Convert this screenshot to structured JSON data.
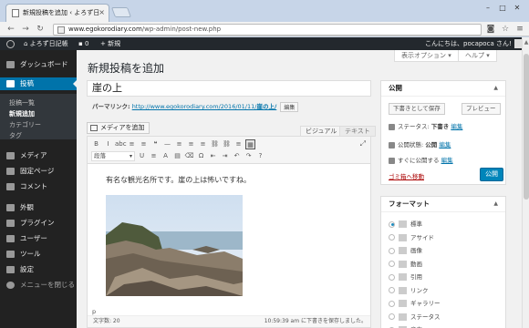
{
  "browser": {
    "tab_title": "新規投稿を追加 ‹ よろず日",
    "url_host": "www.egokorodiary.com",
    "url_path": "/wp-admin/post-new.php"
  },
  "adminbar": {
    "site_name": "よろず日記帳",
    "comments_count": "0",
    "new_label": "新規",
    "greeting": "こんにちは、pocapoca さん!"
  },
  "sidebar": {
    "items": [
      {
        "label": "ダッシュボード"
      },
      {
        "label": "投稿"
      },
      {
        "label": "メディア"
      },
      {
        "label": "固定ページ"
      },
      {
        "label": "コメント"
      },
      {
        "label": "外観"
      },
      {
        "label": "プラグイン"
      },
      {
        "label": "ユーザー"
      },
      {
        "label": "ツール"
      },
      {
        "label": "設定"
      },
      {
        "label": "メニューを閉じる"
      }
    ],
    "submenu": [
      "投稿一覧",
      "新規追加",
      "カテゴリー",
      "タグ"
    ]
  },
  "page": {
    "title": "新規投稿を追加",
    "screen_options": "表示オプション ▾",
    "help": "ヘルプ ▾"
  },
  "post": {
    "title_value": "崖の上",
    "permalink_label": "パーマリンク:",
    "permalink_base": "http://www.egokorodiary.com/2016/01/11/",
    "permalink_slug": "崖の上/",
    "edit_label": "編集"
  },
  "editor": {
    "media_button": "メディアを追加",
    "tab_visual": "ビジュアル",
    "tab_text": "テキスト",
    "format_select": "段落",
    "content_text": "有名な観光名所です。崖の上は怖いですね。",
    "path": "p",
    "word_count": "文字数: 20",
    "draft_status": "10:59:39 am に下書きを保存しました。",
    "toolbar_row1": [
      "B",
      "I",
      "abc",
      "≡",
      "≡",
      "❝",
      "—",
      "≡",
      "≡",
      "≡",
      "⛓",
      "⛓",
      "≡",
      "▦"
    ],
    "toolbar_row2": [
      "U",
      "≡",
      "A",
      "▤",
      "⌫",
      "Ω",
      "⇤",
      "⇥",
      "↶",
      "↷",
      "?"
    ]
  },
  "publish_box": {
    "title": "公開",
    "save_draft": "下書きとして保存",
    "preview": "プレビュー",
    "status_label": "ステータス:",
    "status_value": "下書き",
    "visibility_label": "公開状態:",
    "visibility_value": "公開",
    "schedule_label": "すぐに公開する",
    "edit_link": "編集",
    "trash": "ゴミ箱へ移動",
    "publish": "公開"
  },
  "format_box": {
    "title": "フォーマット",
    "options": [
      "標準",
      "アサイド",
      "画像",
      "動画",
      "引用",
      "リンク",
      "ギャラリー",
      "ステータス",
      "音声"
    ],
    "selected_index": 0
  },
  "colors": {
    "admin_dark": "#23282d",
    "accent": "#0073aa",
    "publish": "#0085ba"
  }
}
